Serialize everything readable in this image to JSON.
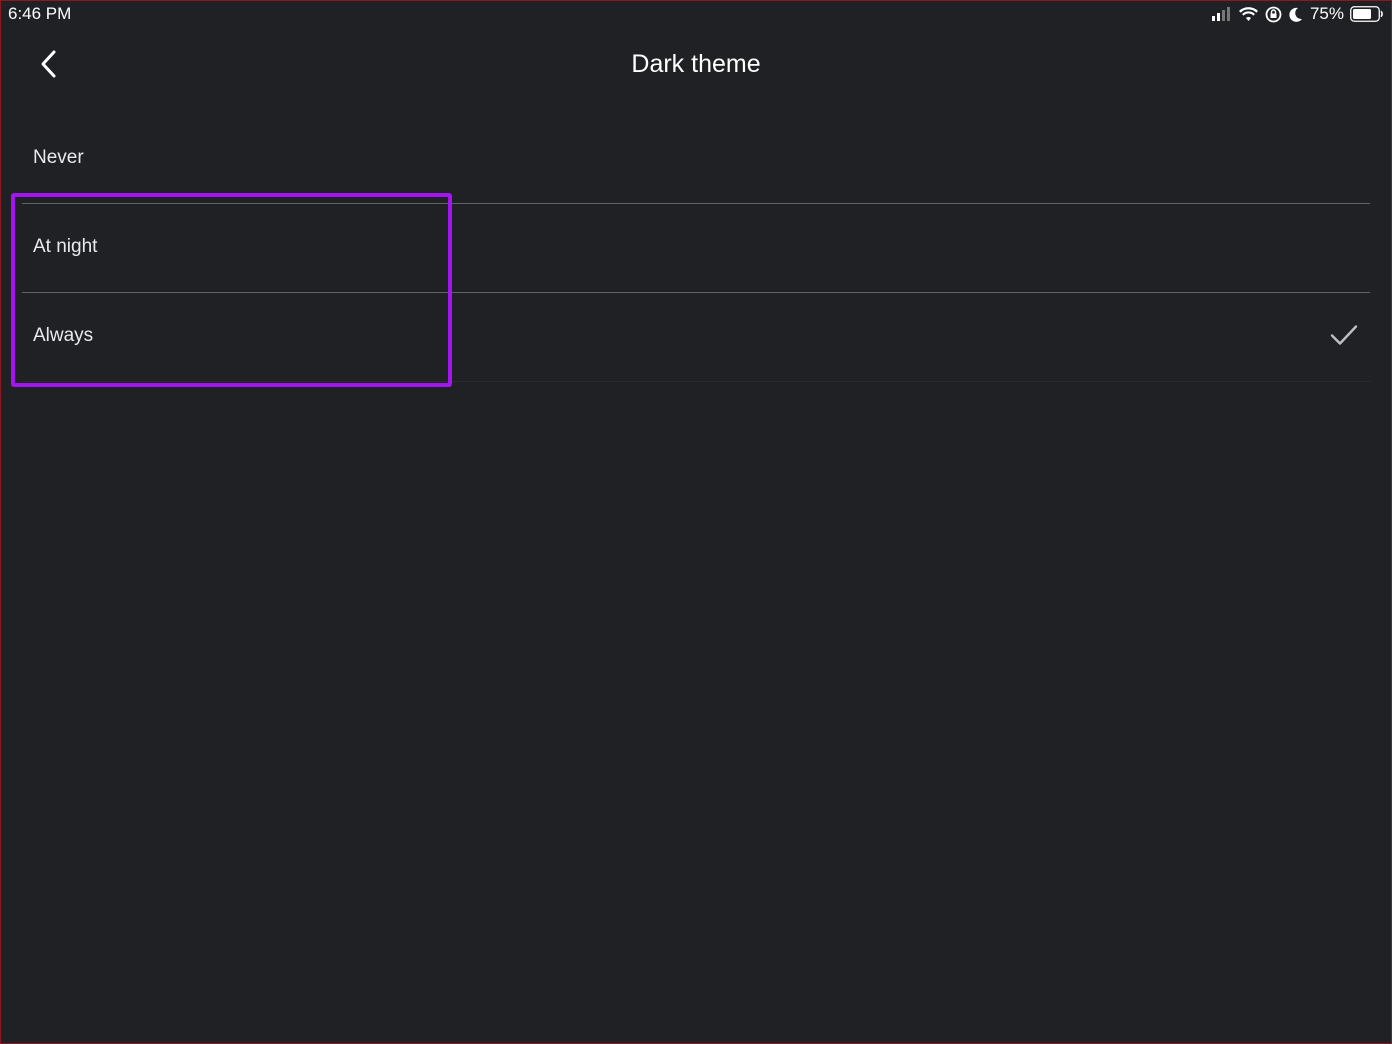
{
  "status_bar": {
    "time": "6:46 PM",
    "battery_percent": "75%",
    "battery_level": 0.75,
    "icons": [
      "signal-icon",
      "wifi-icon",
      "rotation-lock-icon",
      "moon-icon",
      "battery-icon"
    ]
  },
  "nav": {
    "title": "Dark theme",
    "back_icon": "chevron-left-icon"
  },
  "options": [
    {
      "label": "Never",
      "selected": false
    },
    {
      "label": "At night",
      "selected": false
    },
    {
      "label": "Always",
      "selected": true
    }
  ],
  "colors": {
    "background": "#202125",
    "text": "#e8eaed",
    "divider": "#5f6368",
    "highlight": "#a416ef",
    "check": "#bdc1c6"
  }
}
